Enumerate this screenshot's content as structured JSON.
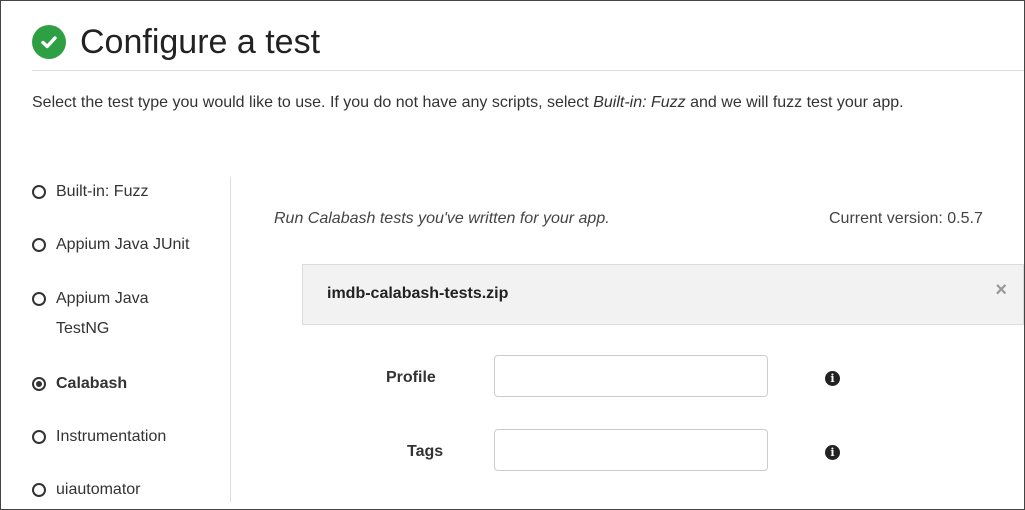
{
  "header": {
    "title": "Configure a test",
    "status_color": "#2ea043"
  },
  "intro": {
    "text_before": "Select the test type you would like to use. If you do not have any scripts, select ",
    "emphasis": "Built-in: Fuzz",
    "text_after": " and we will fuzz test your app."
  },
  "test_types": [
    {
      "label": "Built-in: Fuzz",
      "selected": false
    },
    {
      "label": "Appium Java JUnit",
      "selected": false
    },
    {
      "label": "Appium Java TestNG",
      "selected": false
    },
    {
      "label": "Calabash",
      "selected": true
    },
    {
      "label": "Instrumentation",
      "selected": false
    },
    {
      "label": "uiautomator",
      "selected": false
    }
  ],
  "detail": {
    "description": "Run Calabash tests you've written for your app.",
    "version_label": "Current version: 0.5.7",
    "file_name": "imdb-calabash-tests.zip",
    "remove_glyph": "×"
  },
  "fields": {
    "profile": {
      "label": "Profile",
      "value": "",
      "placeholder": ""
    },
    "tags": {
      "label": "Tags",
      "value": "",
      "placeholder": ""
    }
  },
  "icons": {
    "check": "check-circle-icon",
    "info": "info-icon",
    "remove": "close-icon"
  }
}
